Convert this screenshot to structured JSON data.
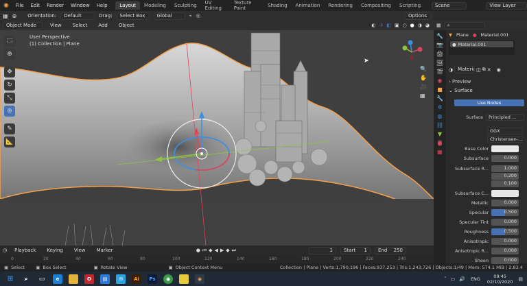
{
  "topbar": {
    "menus": [
      "File",
      "Edit",
      "Render",
      "Window",
      "Help"
    ],
    "tabs": [
      "Layout",
      "Modeling",
      "Sculpting",
      "UV Editing",
      "Texture Paint",
      "Shading",
      "Animation",
      "Rendering",
      "Compositing",
      "Scripting"
    ],
    "active_tab": "Layout",
    "scene": "Scene",
    "view_layer": "View Layer"
  },
  "header": {
    "orientation_label": "Orientation:",
    "orientation_value": "Default",
    "drag_label": "Drag:",
    "drag_value": "Select Box",
    "transform_value": "Global",
    "options": "Options"
  },
  "viewport_header": {
    "mode": "Object Mode",
    "menus": [
      "View",
      "Select",
      "Add",
      "Object"
    ]
  },
  "viewport": {
    "perspective": "User Perspective",
    "collection": "(1) Collection | Plane"
  },
  "properties": {
    "object_name": "Plane",
    "material_top": "Material.001",
    "material_slot": "Material.001",
    "material_field": "Material",
    "preview": "Preview",
    "surface_section": "Surface",
    "use_nodes": "Use Nodes",
    "surface_label": "Surface",
    "surface_value": "Principled ...",
    "distribution": "GGX",
    "subsurface_method": "Christensen-...",
    "rows": [
      {
        "label": "Base Color",
        "value": ""
      },
      {
        "label": "Subsurface",
        "value": "0.000"
      },
      {
        "label": "Subsurface R...",
        "value": "1.000"
      },
      {
        "label": "",
        "value": "0.200"
      },
      {
        "label": "",
        "value": "0.100"
      },
      {
        "label": "Subsurface C...",
        "value": ""
      },
      {
        "label": "Metallic",
        "value": "0.000"
      },
      {
        "label": "Specular",
        "value": "0.500"
      },
      {
        "label": "Specular Tint",
        "value": "0.000"
      },
      {
        "label": "Roughness",
        "value": "0.500"
      },
      {
        "label": "Anisotropic",
        "value": "0.000"
      },
      {
        "label": "Anisotropic R...",
        "value": "0.000"
      },
      {
        "label": "Sheen",
        "value": "0.000"
      }
    ]
  },
  "timeline": {
    "playback": "Playback",
    "keying": "Keying",
    "view": "View",
    "marker": "Marker",
    "current_frame": "1",
    "start_label": "Start",
    "start": "1",
    "end_label": "End",
    "end": "250",
    "ruler": [
      "0",
      "20",
      "40",
      "60",
      "80",
      "100",
      "120",
      "140",
      "160",
      "180",
      "200",
      "220",
      "240"
    ]
  },
  "status": {
    "select": "Select",
    "box_select": "Box Select",
    "rotate_view": "Rotate View",
    "context_menu": "Object Context Menu",
    "stats": "Collection | Plane | Verts:1,790,196 | Faces:937,253 | Tris:1,243,726 | Objects:1/49 | Mem: 574.1 MiB | 2.83.4"
  },
  "taskbar": {
    "lang": "ENG",
    "time": "09:45",
    "date": "02/10/2020"
  },
  "colors": {
    "accent": "#4772b3",
    "orange": "#f5a04a",
    "x_axis": "#e0445a",
    "y_axis": "#8ec63f",
    "z_axis": "#3d8fe0"
  }
}
